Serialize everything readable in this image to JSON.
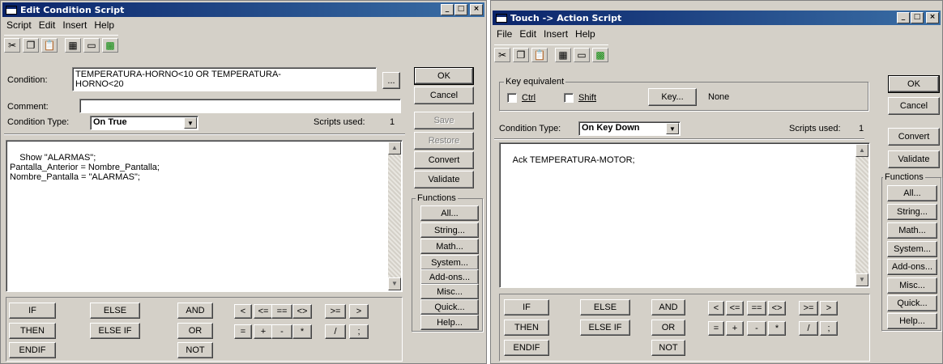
{
  "cond_window": {
    "title": "Edit Condition Script",
    "menu": [
      "Script",
      "Edit",
      "Insert",
      "Help"
    ],
    "condition_label": "Condition:",
    "condition_value": "TEMPERATURA-HORNO<10 OR TEMPERATURA-\nHORNO<20",
    "browse_label": "...",
    "comment_label": "Comment:",
    "comment_value": "",
    "condition_type_label": "Condition Type:",
    "condition_type_value": "On True",
    "scripts_used_label": "Scripts used:",
    "scripts_used_value": "1",
    "script_text": "Show \"ALARMAS\";\nPantalla_Anterior = Nombre_Pantalla;\nNombre_Pantalla = \"ALARMAS\";",
    "buttons": {
      "ok": "OK",
      "cancel": "Cancel",
      "save": "Save",
      "restore": "Restore",
      "convert": "Convert",
      "validate": "Validate"
    },
    "functions_title": "Functions",
    "functions": [
      "All...",
      "String...",
      "Math...",
      "System...",
      "Add-ons...",
      "Misc...",
      "Quick...",
      "Help..."
    ],
    "keywords": {
      "if": "IF",
      "then": "THEN",
      "endif": "ENDIF",
      "else": "ELSE",
      "else_if": "ELSE IF",
      "and": "AND",
      "or": "OR",
      "not": "NOT",
      "lt": "<",
      "lte": "<=",
      "eq": "==",
      "neq": "<>",
      "gte": ">=",
      "gt": ">",
      "assign": "=",
      "plus": "+",
      "minus": "-",
      "times": "*",
      "divide": "/",
      "semicolon": ";"
    }
  },
  "action_window": {
    "title": "Touch -> Action Script",
    "menu": [
      "File",
      "Edit",
      "Insert",
      "Help"
    ],
    "key_equivalent_label": "Key equivalent",
    "ctrl_label": "Ctrl",
    "shift_label": "Shift",
    "key_button": "Key...",
    "key_value": "None",
    "condition_type_label": "Condition Type:",
    "condition_type_value": "On Key Down",
    "scripts_used_label": "Scripts used:",
    "scripts_used_value": "1",
    "script_text": "Ack TEMPERATURA-MOTOR;",
    "buttons": {
      "ok": "OK",
      "cancel": "Cancel",
      "convert": "Convert",
      "validate": "Validate"
    },
    "functions_title": "Functions",
    "functions": [
      "All...",
      "String...",
      "Math...",
      "System...",
      "Add-ons...",
      "Misc...",
      "Quick...",
      "Help..."
    ],
    "keywords": {
      "if": "IF",
      "then": "THEN",
      "endif": "ENDIF",
      "else": "ELSE",
      "else_if": "ELSE IF",
      "and": "AND",
      "or": "OR",
      "not": "NOT",
      "lt": "<",
      "lte": "<=",
      "eq": "==",
      "neq": "<>",
      "gte": ">=",
      "gt": ">",
      "assign": "=",
      "plus": "+",
      "minus": "-",
      "times": "*",
      "divide": "/",
      "semicolon": ";"
    }
  },
  "window_controls": {
    "minimize": "_",
    "maximize": "□",
    "close": "×"
  },
  "toolbar_icons": [
    "cut-icon",
    "copy-icon",
    "paste-icon",
    "find-icon",
    "window-icon",
    "tagname-icon"
  ],
  "colors": {
    "titlebar_start": "#0a246a",
    "titlebar_end": "#3a6ea5",
    "face": "#d4d0c8"
  }
}
